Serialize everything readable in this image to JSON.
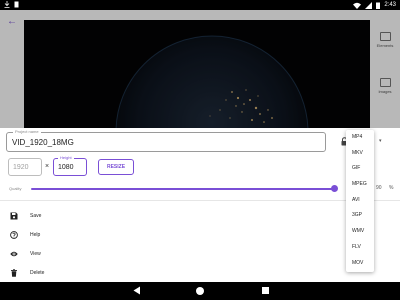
{
  "status_bar": {
    "time": "2:43",
    "icons": [
      "download-icon",
      "doc-icon",
      "wifi-icon",
      "signal-icon",
      "battery-icon"
    ]
  },
  "app": {
    "side_tools": [
      {
        "label": "Elements",
        "icon": "elements-icon"
      },
      {
        "label": "Images",
        "icon": "images-icon"
      }
    ]
  },
  "sheet": {
    "project_label": "Project name",
    "project_name": "VID_1920_18MG",
    "width_value": "1920",
    "times_symbol": "×",
    "height_label": "Height",
    "height_value": "1080",
    "resize_label": "RESIZE",
    "quality_label": "Quality",
    "quality_value": 90,
    "quality_display": "90",
    "quality_unit": "%",
    "menu": [
      {
        "label": "Save",
        "icon": "save-icon"
      },
      {
        "label": "Help",
        "icon": "help-icon"
      },
      {
        "label": "View",
        "icon": "eye-icon"
      },
      {
        "label": "Delete",
        "icon": "trash-icon"
      }
    ]
  },
  "format_menu": {
    "options": [
      "MP4",
      "MKV",
      "GIF",
      "MPEG",
      "AVI",
      "3GP",
      "WMV",
      "FLV",
      "MOV"
    ]
  },
  "colors": {
    "accent": "#7a4fd6",
    "nav_bar": "#000000"
  }
}
